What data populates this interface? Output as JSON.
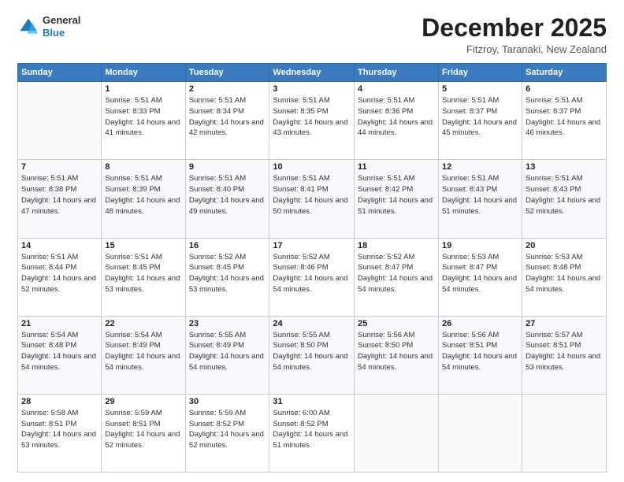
{
  "header": {
    "logo_line1": "General",
    "logo_line2": "Blue",
    "month": "December 2025",
    "location": "Fitzroy, Taranaki, New Zealand"
  },
  "days_of_week": [
    "Sunday",
    "Monday",
    "Tuesday",
    "Wednesday",
    "Thursday",
    "Friday",
    "Saturday"
  ],
  "weeks": [
    [
      {
        "day": "",
        "info": ""
      },
      {
        "day": "1",
        "info": "Sunrise: 5:51 AM\nSunset: 8:33 PM\nDaylight: 14 hours\nand 41 minutes."
      },
      {
        "day": "2",
        "info": "Sunrise: 5:51 AM\nSunset: 8:34 PM\nDaylight: 14 hours\nand 42 minutes."
      },
      {
        "day": "3",
        "info": "Sunrise: 5:51 AM\nSunset: 8:35 PM\nDaylight: 14 hours\nand 43 minutes."
      },
      {
        "day": "4",
        "info": "Sunrise: 5:51 AM\nSunset: 8:36 PM\nDaylight: 14 hours\nand 44 minutes."
      },
      {
        "day": "5",
        "info": "Sunrise: 5:51 AM\nSunset: 8:37 PM\nDaylight: 14 hours\nand 45 minutes."
      },
      {
        "day": "6",
        "info": "Sunrise: 5:51 AM\nSunset: 8:37 PM\nDaylight: 14 hours\nand 46 minutes."
      }
    ],
    [
      {
        "day": "7",
        "info": "Sunrise: 5:51 AM\nSunset: 8:38 PM\nDaylight: 14 hours\nand 47 minutes."
      },
      {
        "day": "8",
        "info": "Sunrise: 5:51 AM\nSunset: 8:39 PM\nDaylight: 14 hours\nand 48 minutes."
      },
      {
        "day": "9",
        "info": "Sunrise: 5:51 AM\nSunset: 8:40 PM\nDaylight: 14 hours\nand 49 minutes."
      },
      {
        "day": "10",
        "info": "Sunrise: 5:51 AM\nSunset: 8:41 PM\nDaylight: 14 hours\nand 50 minutes."
      },
      {
        "day": "11",
        "info": "Sunrise: 5:51 AM\nSunset: 8:42 PM\nDaylight: 14 hours\nand 51 minutes."
      },
      {
        "day": "12",
        "info": "Sunrise: 5:51 AM\nSunset: 8:43 PM\nDaylight: 14 hours\nand 51 minutes."
      },
      {
        "day": "13",
        "info": "Sunrise: 5:51 AM\nSunset: 8:43 PM\nDaylight: 14 hours\nand 52 minutes."
      }
    ],
    [
      {
        "day": "14",
        "info": "Sunrise: 5:51 AM\nSunset: 8:44 PM\nDaylight: 14 hours\nand 52 minutes."
      },
      {
        "day": "15",
        "info": "Sunrise: 5:51 AM\nSunset: 8:45 PM\nDaylight: 14 hours\nand 53 minutes."
      },
      {
        "day": "16",
        "info": "Sunrise: 5:52 AM\nSunset: 8:45 PM\nDaylight: 14 hours\nand 53 minutes."
      },
      {
        "day": "17",
        "info": "Sunrise: 5:52 AM\nSunset: 8:46 PM\nDaylight: 14 hours\nand 54 minutes."
      },
      {
        "day": "18",
        "info": "Sunrise: 5:52 AM\nSunset: 8:47 PM\nDaylight: 14 hours\nand 54 minutes."
      },
      {
        "day": "19",
        "info": "Sunrise: 5:53 AM\nSunset: 8:47 PM\nDaylight: 14 hours\nand 54 minutes."
      },
      {
        "day": "20",
        "info": "Sunrise: 5:53 AM\nSunset: 8:48 PM\nDaylight: 14 hours\nand 54 minutes."
      }
    ],
    [
      {
        "day": "21",
        "info": "Sunrise: 5:54 AM\nSunset: 8:48 PM\nDaylight: 14 hours\nand 54 minutes."
      },
      {
        "day": "22",
        "info": "Sunrise: 5:54 AM\nSunset: 8:49 PM\nDaylight: 14 hours\nand 54 minutes."
      },
      {
        "day": "23",
        "info": "Sunrise: 5:55 AM\nSunset: 8:49 PM\nDaylight: 14 hours\nand 54 minutes."
      },
      {
        "day": "24",
        "info": "Sunrise: 5:55 AM\nSunset: 8:50 PM\nDaylight: 14 hours\nand 54 minutes."
      },
      {
        "day": "25",
        "info": "Sunrise: 5:56 AM\nSunset: 8:50 PM\nDaylight: 14 hours\nand 54 minutes."
      },
      {
        "day": "26",
        "info": "Sunrise: 5:56 AM\nSunset: 8:51 PM\nDaylight: 14 hours\nand 54 minutes."
      },
      {
        "day": "27",
        "info": "Sunrise: 5:57 AM\nSunset: 8:51 PM\nDaylight: 14 hours\nand 53 minutes."
      }
    ],
    [
      {
        "day": "28",
        "info": "Sunrise: 5:58 AM\nSunset: 8:51 PM\nDaylight: 14 hours\nand 53 minutes."
      },
      {
        "day": "29",
        "info": "Sunrise: 5:59 AM\nSunset: 8:51 PM\nDaylight: 14 hours\nand 52 minutes."
      },
      {
        "day": "30",
        "info": "Sunrise: 5:59 AM\nSunset: 8:52 PM\nDaylight: 14 hours\nand 52 minutes."
      },
      {
        "day": "31",
        "info": "Sunrise: 6:00 AM\nSunset: 8:52 PM\nDaylight: 14 hours\nand 51 minutes."
      },
      {
        "day": "",
        "info": ""
      },
      {
        "day": "",
        "info": ""
      },
      {
        "day": "",
        "info": ""
      }
    ]
  ]
}
